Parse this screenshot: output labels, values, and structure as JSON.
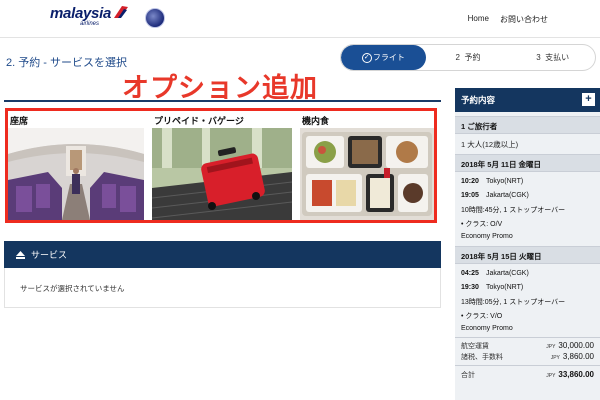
{
  "header": {
    "logo_text": "malaysia",
    "logo_sub": "airlines",
    "nav": [
      {
        "label": "Home"
      },
      {
        "label": "お問い合わせ"
      }
    ]
  },
  "page": {
    "title": "2. 予約 - サービスを選択",
    "annotation": "オプション追加"
  },
  "steps": [
    {
      "label": "フライト",
      "active": true
    },
    {
      "label": "2  予約",
      "active": false
    },
    {
      "label": "3  支払い",
      "active": false
    }
  ],
  "options": [
    {
      "label": "座席",
      "image": "airplane-cabin"
    },
    {
      "label": "プリペイド・バゲージ",
      "image": "red-suitcase"
    },
    {
      "label": "機内食",
      "image": "meal-tray"
    }
  ],
  "services": {
    "title": "サービス",
    "empty_text": "サービスが選択されていません"
  },
  "summary": {
    "title": "予約内容",
    "passengers_header": "1 ご旅行者",
    "passengers_detail": "1 大人(12歳以上)",
    "legs": [
      {
        "date": "2018年 5月 11日 金曜日",
        "dep_time": "10:20",
        "dep_place": "Tokyo(NRT)",
        "arr_time": "19:05",
        "arr_place": "Jakarta(CGK)",
        "duration": "10時間:45分, 1 ストップオーバー",
        "class": "• クラス: O/V",
        "fare": "Economy Promo"
      },
      {
        "date": "2018年 5月 15日 火曜日",
        "dep_time": "04:25",
        "dep_place": "Jakarta(CGK)",
        "arr_time": "19:30",
        "arr_place": "Tokyo(NRT)",
        "duration": "13時間:05分, 1 ストップオーバー",
        "class": "• クラス: V/O",
        "fare": "Economy Promo"
      }
    ],
    "fares": [
      {
        "label": "航空運賃",
        "currency": "JPY",
        "amount": "30,000.00"
      },
      {
        "label": "諸税、手数料",
        "currency": "JPY",
        "amount": "3,860.00"
      }
    ],
    "total": {
      "label": "合計",
      "currency": "JPY",
      "amount": "33,860.00"
    }
  },
  "colors": {
    "brand_navy": "#14365f",
    "step_active": "#1a4f95",
    "annotation_red": "#e8382a"
  }
}
